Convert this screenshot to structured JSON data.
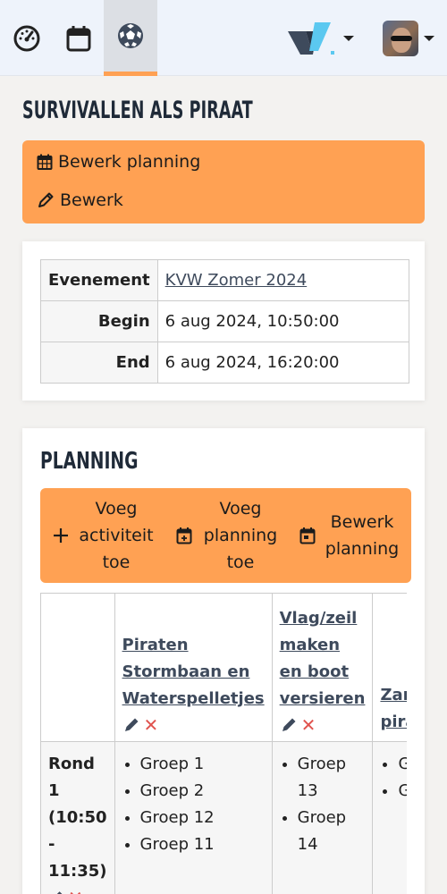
{
  "nav": {
    "icons": [
      "dashboard-icon",
      "calendar-icon",
      "soccer-ball-icon"
    ],
    "active": "soccer-ball-icon"
  },
  "page_title": "SURVIVALLEN ALS PIRAAT",
  "actions": {
    "edit_planning": "Bewerk planning",
    "edit": "Bewerk"
  },
  "details": {
    "rows": [
      {
        "key": "Evenement",
        "value": "KVW Zomer 2024",
        "is_link": true
      },
      {
        "key": "Begin",
        "value": "6 aug 2024, 10:50:00",
        "is_link": false
      },
      {
        "key": "End",
        "value": "6 aug 2024, 16:20:00",
        "is_link": false
      }
    ]
  },
  "planning": {
    "title": "PLANNING",
    "buttons": {
      "add_activity": "Voeg activiteit toe",
      "add_planning": "Voeg planning toe",
      "edit_planning": "Bewerk planning"
    },
    "columns": [
      {
        "title": "Piraten Stormbaan en Waterspelletjes"
      },
      {
        "title": "Vlag/zeil maken en boot versieren"
      },
      {
        "title": "Zandbouw pirattatto"
      }
    ],
    "rows": [
      {
        "round": "Rond 1 (10:50 - 11:35)",
        "cells": [
          [
            "Groep 1",
            "Groep 2",
            "Groep 12",
            "Groep 11"
          ],
          [
            "Groep 13",
            "Groep 14"
          ],
          [
            "Gr",
            "Gr"
          ]
        ]
      }
    ]
  },
  "colors": {
    "accent": "#ffa153",
    "nav_bg": "#eef3fb",
    "link": "#3e4a5c",
    "delete": "#e0534e"
  }
}
